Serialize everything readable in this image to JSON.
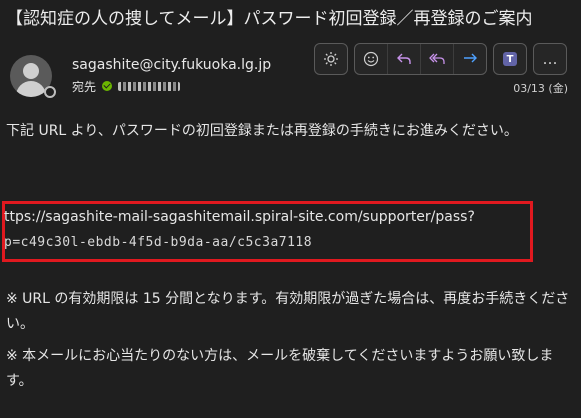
{
  "email": {
    "subject": "【認知症の人の捜してメール】パスワード初回登録／再登録のご案内",
    "sender": "sagashite@city.fukuoka.lg.jp",
    "to_label": "宛先",
    "date": "03/13 (金)"
  },
  "toolbar": {
    "icons": [
      "sun-icon",
      "emoji-icon",
      "reply-icon",
      "reply-all-icon",
      "forward-icon",
      "teams-icon",
      "more-icon"
    ],
    "more_label": "…",
    "teams_label": "T"
  },
  "body": {
    "intro": "下記 URL より、パスワードの初回登録または再登録の手続きにお進みください。",
    "url_line1": "ttps://sagashite-mail-sagashitemail.spiral-site.com/supporter/pass?",
    "url_line2": "p=c49c30l-ebdb-4f5d-b9da-aa/c5c3a7118",
    "note1": "※ URL の有効期限は 15 分間となります。有効期限が過ぎた場合は、再度お手続きください。",
    "note2": "※ 本メールにお心当たりのない方は、メールを破棄してくださいますようお願い致します。"
  },
  "colors": {
    "background": "#1f1f1f",
    "highlight_border": "#e0191f",
    "reply_icons": "#c792ea",
    "forward_icon": "#4ea1ff",
    "presence_check": "#6bb700"
  }
}
